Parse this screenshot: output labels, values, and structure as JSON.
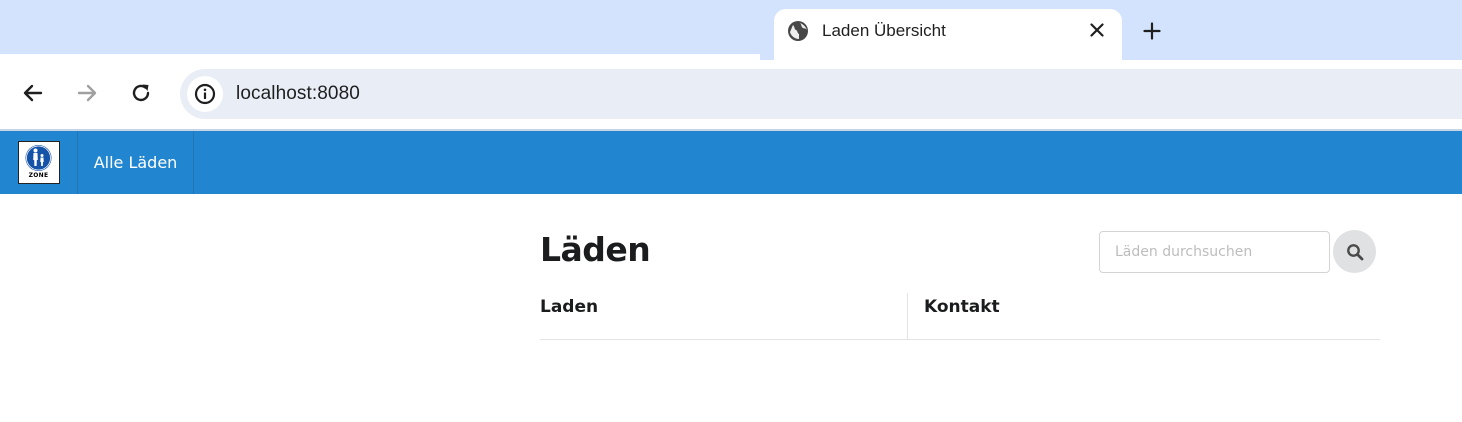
{
  "browser": {
    "tab": {
      "title": "Laden Übersicht",
      "icon": "globe-icon"
    },
    "new_tab_icon": "plus-icon",
    "close_tab_icon": "close-icon",
    "nav": {
      "back_icon": "back-arrow-icon",
      "forward_icon": "forward-arrow-icon",
      "reload_icon": "reload-icon"
    },
    "address_bar": {
      "site_info_icon": "info-icon",
      "url": "localhost:8080"
    }
  },
  "navbar": {
    "color": "#2185d0",
    "logo": "pedestrian-zone-sign-logo",
    "logo_text": "ZONE",
    "items": [
      {
        "label": "Alle Läden"
      }
    ]
  },
  "main": {
    "title": "Läden",
    "search": {
      "placeholder": "Läden durchsuchen",
      "value": "",
      "button_icon": "search-icon"
    },
    "table": {
      "columns": [
        "Laden",
        "Kontakt"
      ],
      "rows": []
    }
  }
}
